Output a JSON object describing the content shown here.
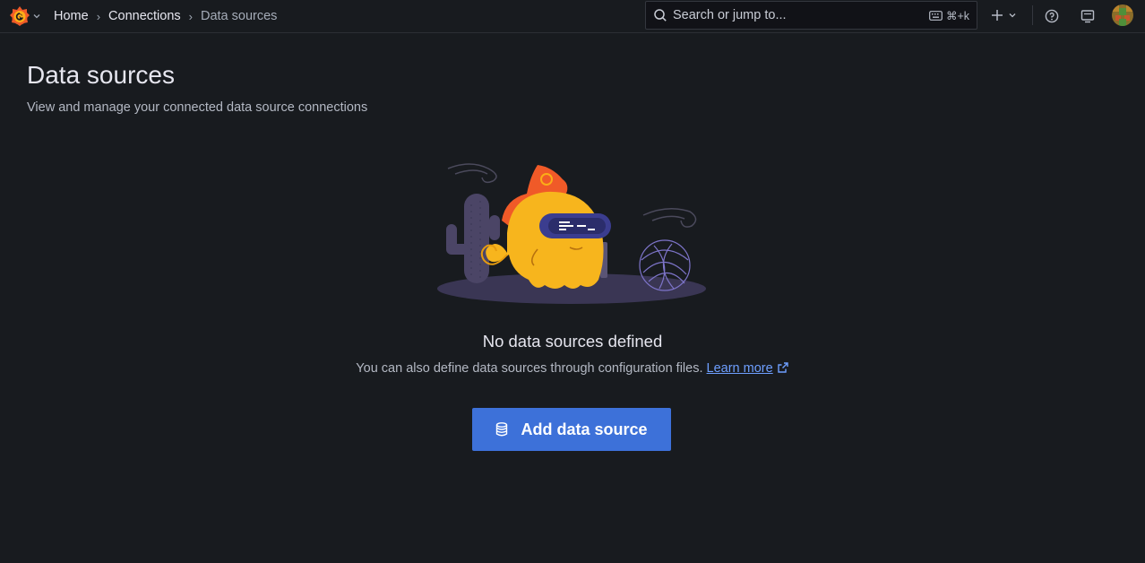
{
  "topbar": {
    "logo_icon": "grafana-logo-icon",
    "breadcrumb": [
      "Home",
      "Connections",
      "Data sources"
    ],
    "search_placeholder": "Search or jump to...",
    "search_shortcut": "⌘+k",
    "icons": [
      "search-icon",
      "keyboard-icon",
      "plus-icon",
      "chevron-down-icon",
      "help-icon",
      "news-icon",
      "avatar"
    ]
  },
  "page": {
    "title": "Data sources",
    "subtitle": "View and manage your connected data source connections"
  },
  "empty_state": {
    "title": "No data sources defined",
    "description": "You can also define data sources through configuration files.",
    "link_label": "Learn more",
    "button_label": "Add data source"
  },
  "colors": {
    "background": "#181b1f",
    "primary_button": "#3d71d9",
    "link": "#6e9fff",
    "mascot_yellow": "#f7b51d",
    "mascot_orange": "#f05a28"
  }
}
